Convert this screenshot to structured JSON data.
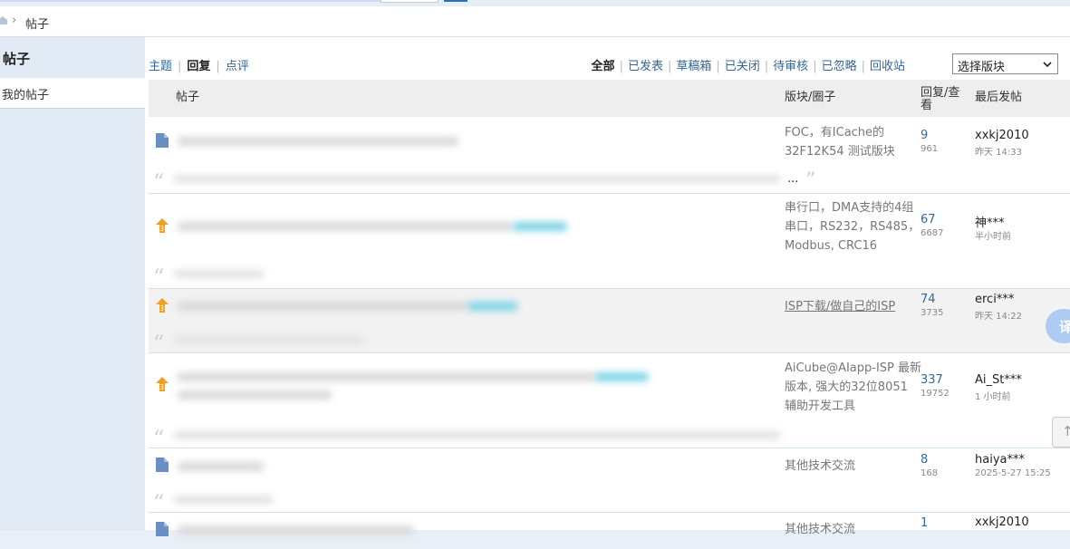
{
  "breadcrumb": {
    "separator": "›",
    "current": "帖子"
  },
  "sidebar": {
    "title": "帖子",
    "items": [
      {
        "label": "我的帖子"
      }
    ]
  },
  "tabs": [
    {
      "label": "主题",
      "active": false
    },
    {
      "label": "回复",
      "active": true
    },
    {
      "label": "点评",
      "active": false
    }
  ],
  "tab_separator": "|",
  "filters": [
    {
      "label": "全部",
      "active": true
    },
    {
      "label": "已发表",
      "active": false
    },
    {
      "label": "草稿箱",
      "active": false
    },
    {
      "label": "已关闭",
      "active": false
    },
    {
      "label": "待审核",
      "active": false
    },
    {
      "label": "已忽略",
      "active": false
    },
    {
      "label": "回收站",
      "active": false
    }
  ],
  "forum_select": {
    "selected": "选择版块"
  },
  "table": {
    "headers": {
      "post": "帖子",
      "forum": "版块/圈子",
      "replies_views": "回复/查看",
      "last_post": "最后发帖"
    },
    "rows": [
      {
        "icon": "document-icon",
        "forum": "FOC，有ICache的32F12K54 测试版块",
        "replies": "9",
        "views": "961",
        "last_user": "xxkj2010",
        "last_time": "昨天 14:33",
        "ellipsis": "...",
        "underlined": false
      },
      {
        "icon": "hot-thread-icon",
        "forum": "串行口，DMA支持的4组串口，RS232，RS485，Modbus, CRC16",
        "replies": "67",
        "views": "6687",
        "last_user": "神***",
        "last_time": "半小时前",
        "underlined": false
      },
      {
        "icon": "hot-thread-icon",
        "forum": "ISP下载/做自己的ISP",
        "replies": "74",
        "views": "3735",
        "last_user": "erci***",
        "last_time": "昨天 14:22",
        "underlined": true
      },
      {
        "icon": "hot-thread-icon",
        "forum": "AiCube@AIapp-ISP 最新版本, 强大的32位8051 辅助开发工具",
        "replies": "337",
        "views": "19752",
        "last_user": "Ai_St***",
        "last_time": "1 小时前",
        "underlined": false
      },
      {
        "icon": "document-icon",
        "forum": "其他技术交流",
        "replies": "8",
        "views": "168",
        "last_user": "haiya***",
        "last_time": "2025-5-27 15:25",
        "underlined": false
      },
      {
        "icon": "document-icon",
        "forum": "其他技术交流",
        "replies": "1",
        "views": "",
        "last_user": "xxkj2010",
        "last_time": "",
        "underlined": false
      }
    ]
  },
  "floating": {
    "translate_label": "译",
    "back_label": "↑"
  },
  "colors": {
    "link": "#336699",
    "header_bg": "#eeeeee",
    "sidebar_bg": "#e2ebf5",
    "hot_icon": "#f0a020",
    "doc_icon": "#6b8fc4"
  }
}
